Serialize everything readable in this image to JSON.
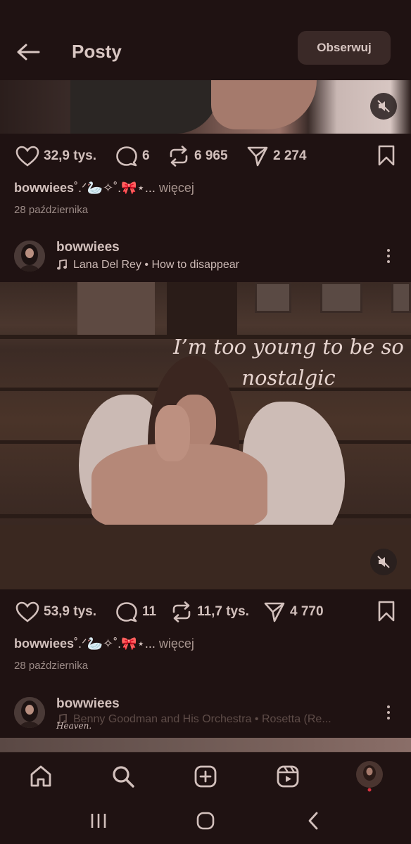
{
  "header": {
    "title": "Posty",
    "follow_label": "Obserwuj"
  },
  "post1": {
    "likes": "32,9 tys.",
    "comments": "6",
    "reposts": "6 965",
    "shares": "2 274",
    "caption_user": "bowwiees",
    "caption_text": "˚.ᐟ🦢✧˚.🎀⋆...",
    "caption_more": "więcej",
    "date": "28 października"
  },
  "post2": {
    "username": "bowwiees",
    "music": "Lana Del Rey • How to disappear",
    "overlay_line1": "I’m too young to be so",
    "overlay_line2": "nostalgic",
    "likes": "53,9 tys.",
    "comments": "11",
    "reposts": "11,7 tys.",
    "shares": "4 770",
    "caption_user": "bowwiees",
    "caption_text": "˚.ᐟ🦢✧˚.🎀⋆...",
    "caption_more": "więcej",
    "date": "28 października"
  },
  "post3": {
    "username": "bowwiees",
    "music": "Benny Goodman and His Orchestra • Rosetta (Re...",
    "watermark": "Heaven."
  },
  "bottom_nav": [
    "home-icon",
    "search-icon",
    "create-icon",
    "reels-icon",
    "profile-avatar"
  ],
  "system_nav": [
    "recents-icon",
    "home-circle-icon",
    "back-chevron-icon"
  ]
}
